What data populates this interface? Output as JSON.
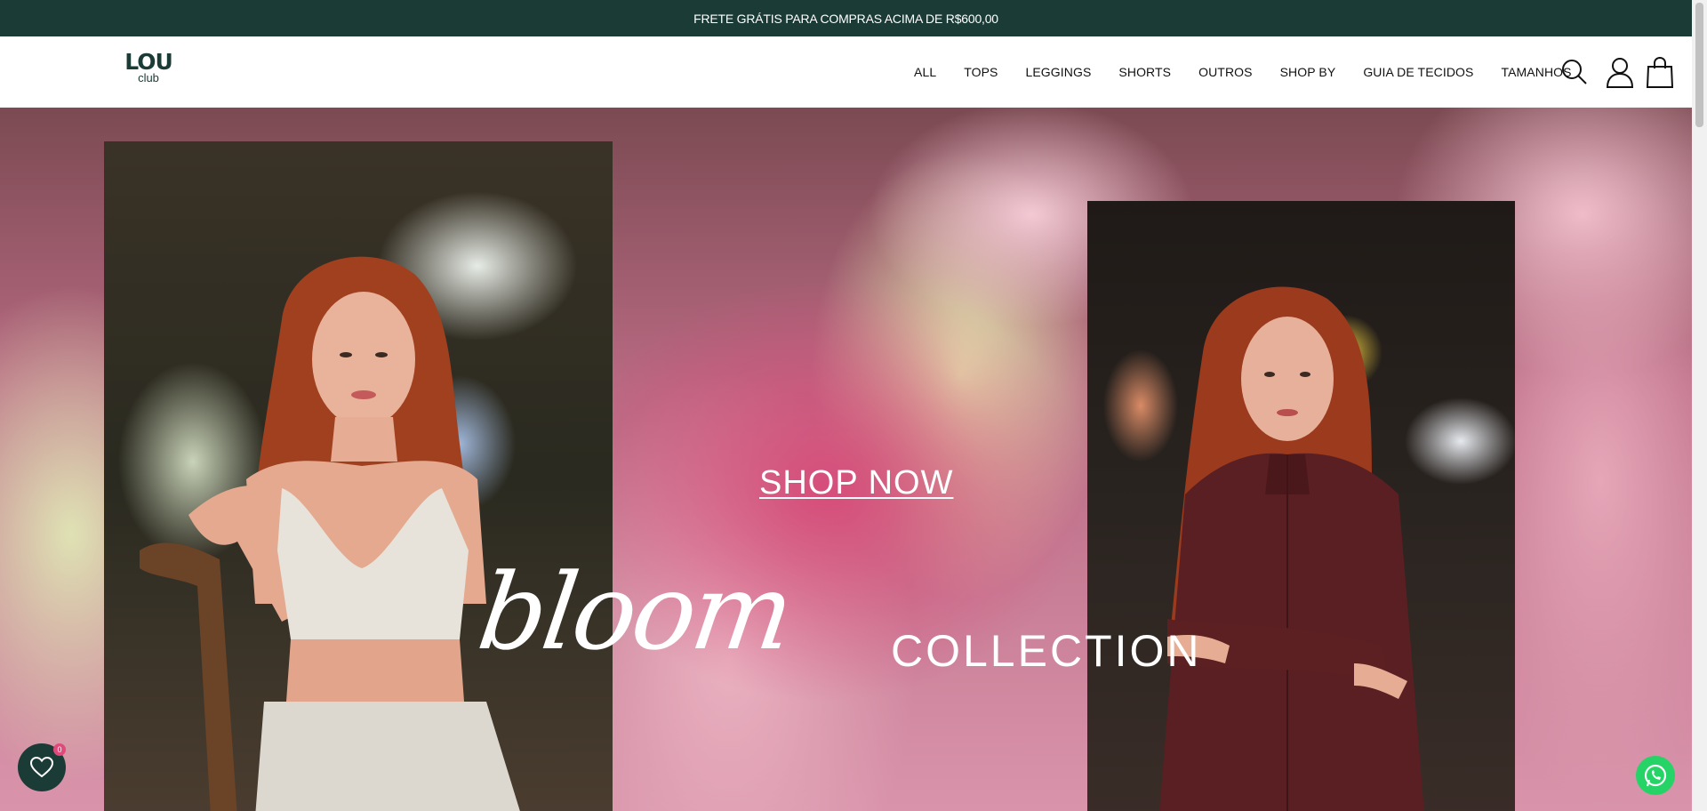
{
  "announcement": {
    "text": "FRETE GRÁTIS PARA COMPRAS ACIMA DE R$600,00"
  },
  "header": {
    "logo": {
      "line1": "LOU",
      "line2": "club"
    },
    "nav": [
      "ALL",
      "TOPS",
      "LEGGINGS",
      "SHORTS",
      "OUTROS",
      "SHOP BY",
      "GUIA DE TECIDOS",
      "TAMANHOS"
    ],
    "icons": [
      "search-icon",
      "user-icon",
      "shopping-bag-icon"
    ]
  },
  "hero": {
    "cta": "SHOP NOW",
    "script_title": "bloom",
    "subtitle": "COLLECTION"
  },
  "widgets": {
    "wishlist_count": "0",
    "wishlist_icon": "heart-icon",
    "whatsapp_icon": "whatsapp-icon"
  },
  "colors": {
    "brand": "#1b3b36",
    "badge": "#e04a7a",
    "whatsapp": "#25d366"
  }
}
